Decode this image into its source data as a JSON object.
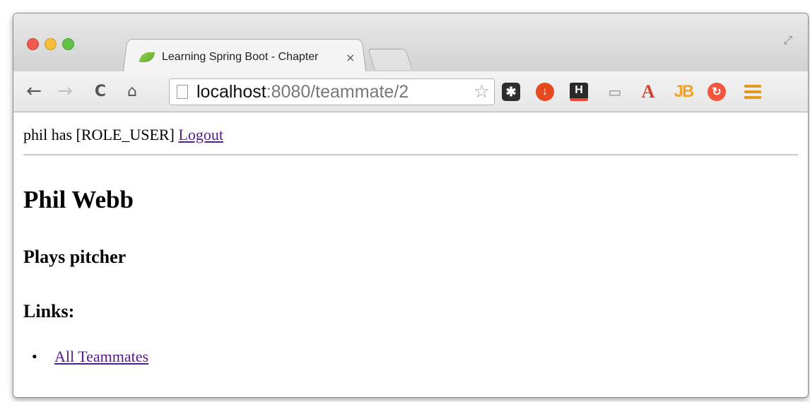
{
  "browser": {
    "tab": {
      "title": "Learning Spring Boot - Chapter",
      "close_glyph": "×"
    },
    "toolbar": {
      "back_glyph": "←",
      "forward_glyph": "→",
      "reload_glyph": "C",
      "home_glyph": "⌂",
      "url_host": "localhost",
      "url_rest": ":8080/teammate/2",
      "star_glyph": "☆"
    },
    "extensions": {
      "e1": "✱",
      "e2": "↓",
      "e3": "H",
      "e4": "▭",
      "e5": "A",
      "e6": "JB",
      "e7": "↻"
    },
    "accent_colors": {
      "close": "#ee5a4f",
      "minimize": "#f5be3a",
      "maximize": "#63c348",
      "menu": "#e19a20",
      "visited_link": "#551a8b"
    },
    "icons": [
      "spring-leaf-icon",
      "page-icon",
      "star-icon",
      "menu-icon",
      "fullscreen-icon"
    ]
  },
  "page": {
    "user_text": "phil has [ROLE_USER]",
    "logout_label": "Logout",
    "name": "Phil Webb",
    "position": "Plays pitcher",
    "links_heading": "Links:",
    "links": [
      {
        "label": "All Teammates"
      }
    ]
  }
}
